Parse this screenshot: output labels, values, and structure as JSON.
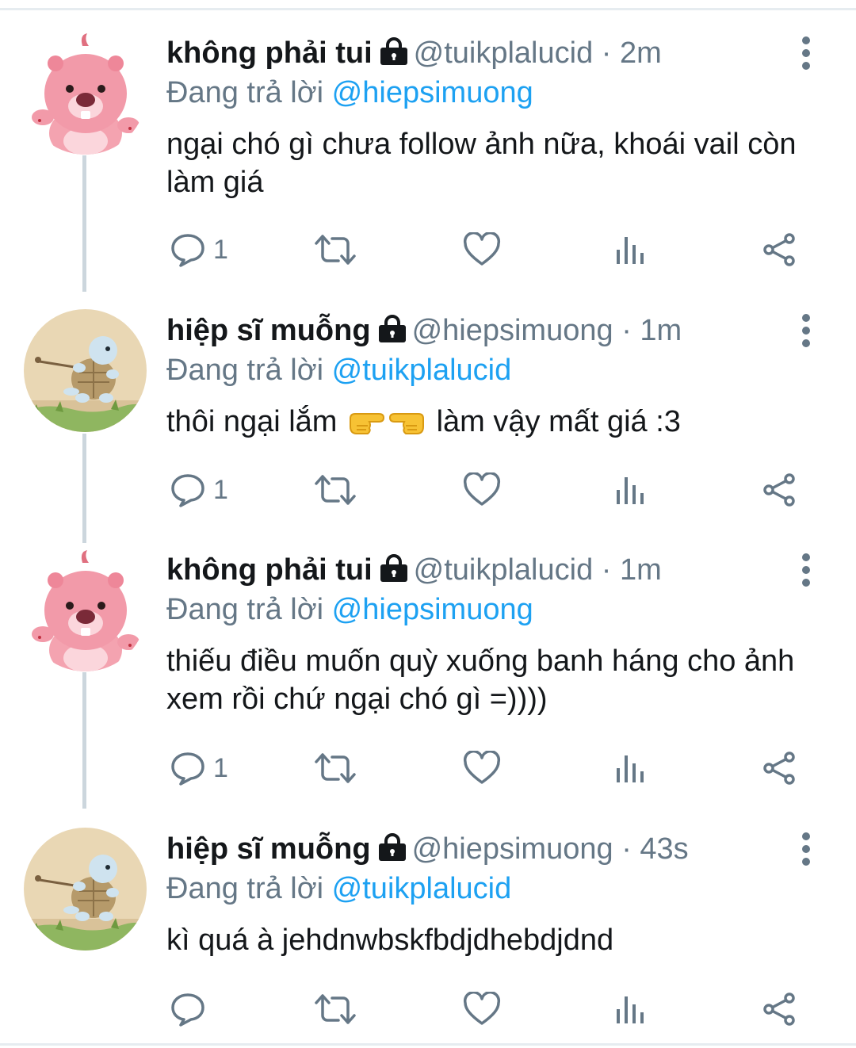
{
  "tweets": [
    {
      "name": "không phải tui",
      "handle": "@tuikplalucid",
      "separator": "·",
      "time": "2m",
      "reply_prefix": "Đang trả lời",
      "reply_to": "@hiepsimuong",
      "text": "ngại chó gì chưa follow ảnh nữa, khoái vail còn làm giá",
      "reply_count": "1",
      "avatar": "pink-beaver-avatar"
    },
    {
      "name": "hiệp sĩ muỗng",
      "handle": "@hiepsimuong",
      "separator": "·",
      "time": "1m",
      "reply_prefix": "Đang trả lời",
      "reply_to": "@tuikplalucid",
      "text_before": "thôi ngại lắm",
      "emojis": [
        "backhand-index-pointing-right",
        "backhand-index-pointing-left"
      ],
      "text_after": "làm vậy mất giá :3",
      "reply_count": "1",
      "avatar": "turtle-cartoon-avatar"
    },
    {
      "name": "không phải tui",
      "handle": "@tuikplalucid",
      "separator": "·",
      "time": "1m",
      "reply_prefix": "Đang trả lời",
      "reply_to": "@hiepsimuong",
      "text": "thiếu điều muốn quỳ xuống banh háng cho ảnh xem rồi chứ ngại chó gì =))))",
      "reply_count": "1",
      "avatar": "pink-beaver-avatar"
    },
    {
      "name": "hiệp sĩ muỗng",
      "handle": "@hiepsimuong",
      "separator": "·",
      "time": "43s",
      "reply_prefix": "Đang trả lời",
      "reply_to": "@tuikplalucid",
      "text": "kì quá à jehdnwbskfbdjdhebdjdnd",
      "reply_count": "",
      "avatar": "turtle-cartoon-avatar"
    }
  ],
  "icons": [
    "lock-icon",
    "more-icon",
    "reply-icon",
    "retweet-icon",
    "like-icon",
    "analytics-icon",
    "share-icon"
  ],
  "colors": {
    "text": "#14171a",
    "secondary": "#657786",
    "link": "#1da1f2",
    "divider": "#ccd6dd"
  }
}
